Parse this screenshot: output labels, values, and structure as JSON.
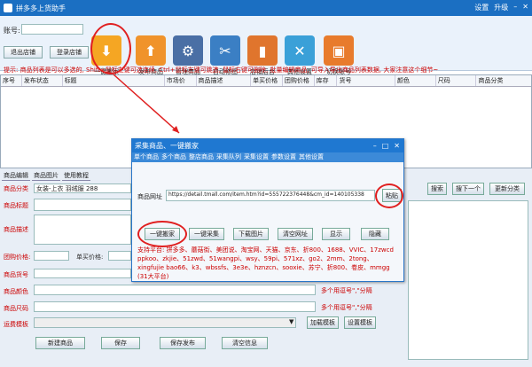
{
  "app": {
    "title": "拼多多上货助手",
    "controls": [
      "设置",
      "升级",
      "最小化",
      "关闭"
    ]
  },
  "account": {
    "label": "账号:",
    "logout": "退出店铺",
    "login": "登录店铺"
  },
  "toolbar": [
    {
      "label": "一键搬家",
      "icon": "cloud-download-icon",
      "color": "#f5a623"
    },
    {
      "label": "发布商品",
      "icon": "cloud-upload-icon",
      "color": "#f0932b"
    },
    {
      "label": "管理商品",
      "icon": "gear-icon",
      "color": "#4a6fa5"
    },
    {
      "label": "自动修图",
      "icon": "scissors-icon",
      "color": "#3b7fc4"
    },
    {
      "label": "店铺后台",
      "icon": "bookmark-icon",
      "color": "#e0752d"
    },
    {
      "label": "其他设置",
      "icon": "tools-icon",
      "color": "#3aa0d8"
    },
    {
      "label": "切换账号",
      "icon": "briefcase-icon",
      "color": "#e87b2c"
    }
  ],
  "hint": "提示: 商品列表是可以多选的, Shift+鼠标左键可选连续, Ctrl+鼠标左键可跳选, 鼠标右键可删除, 批量编辑商品, 可导入导出商品列表数据, 大家注意这个细节~",
  "grid_headers": [
    "序号",
    "发布状态",
    "标题",
    "市场价",
    "商品描述",
    "单买价格",
    "团购价格",
    "库存",
    "货号",
    "颜色",
    "尺码",
    "商品分类"
  ],
  "edit": {
    "tabs": [
      "商品编辑",
      "商品图片",
      "使用教程"
    ],
    "category_label": "商品分类",
    "category_value": "女装-上衣 羽绒服 288",
    "title_label": "商品标题",
    "desc_label": "商品描述",
    "group_price_label": "团购价格:",
    "single_price_label": "单买价格:",
    "code_label": "商品货号",
    "color_label": "商品颜色",
    "size_label": "商品尺码",
    "ship_label": "运费模板",
    "multi_note_1": "多个用逗号\",\"分隔",
    "multi_note_2": "多个用逗号\",\"分隔",
    "load_tpl": "加载模板",
    "set_tpl": "设置模板",
    "buttons": [
      "新建商品",
      "保存",
      "保存发布",
      "清空信息"
    ],
    "search": "搜索",
    "next": "搜下一个",
    "update_cat": "更新分类"
  },
  "dialog": {
    "title": "采集商品、一键搬家",
    "menu": [
      "单个商品",
      "多个商品",
      "整店商品",
      "采集队列",
      "采集设置",
      "参数设置",
      "其他设置"
    ],
    "url_label": "商品网址",
    "url_value": "https://detail.tmall.com/item.htm?id=555722376448&cm_id=140105338",
    "paste": "粘贴",
    "actions": [
      "一键搬家",
      "一键采集",
      "下载图片",
      "清空网址",
      "显示",
      "隐藏"
    ],
    "support": "支持平台: 拼多多、蘑菇街、美团说、淘宝网、天猫、京东、折800、1688、VVIC、17zwcd ppkoo、zkjie、51zwd、51wangpi、wsy、59pi、571xz、go2、2mm、2tong、xingfujie bao66、k3、wbssfs、3e3e、hznzcn、sooxie、苏宁、折800、卷皮、mmgg (31大平台)"
  }
}
